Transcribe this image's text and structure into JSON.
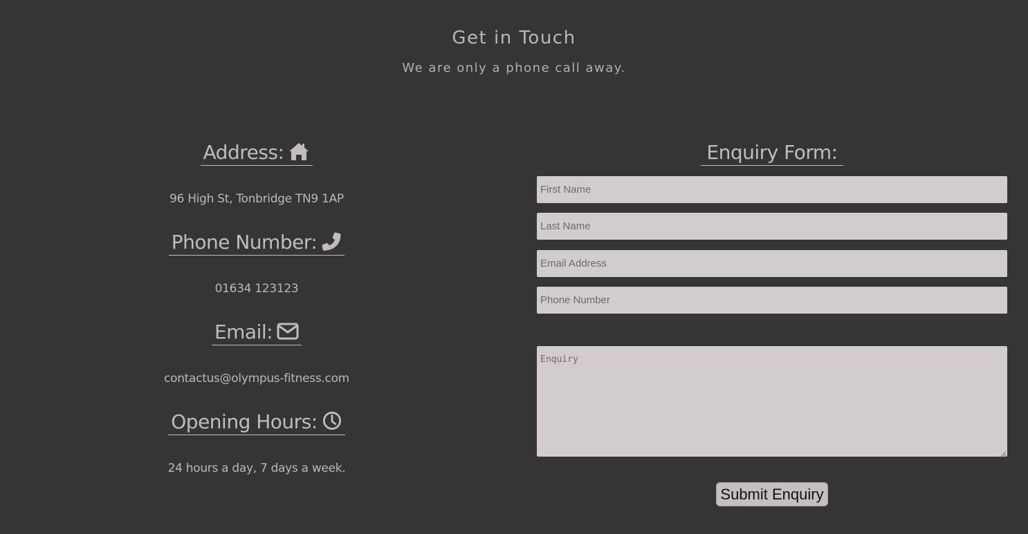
{
  "header": {
    "title": "Get in Touch",
    "subtitle": "We are only a phone call away."
  },
  "contact": {
    "address": {
      "heading": "Address:",
      "value": "96 High St, Tonbridge TN9 1AP",
      "icon": "home-icon"
    },
    "phone": {
      "heading": "Phone Number:",
      "value": "01634 123123",
      "icon": "phone-icon"
    },
    "email": {
      "heading": "Email:",
      "value": "contactus@olympus-fitness.com",
      "icon": "envelope-icon"
    },
    "hours": {
      "heading": "Opening Hours:",
      "value": "24 hours a day, 7 days a week.",
      "icon": "clock-icon"
    }
  },
  "form": {
    "heading": "Enquiry Form:",
    "first_name": {
      "placeholder": "First Name",
      "value": ""
    },
    "last_name": {
      "placeholder": "Last Name",
      "value": ""
    },
    "email": {
      "placeholder": "Email Address",
      "value": ""
    },
    "phone": {
      "placeholder": "Phone Number",
      "value": ""
    },
    "enquiry": {
      "placeholder": "Enquiry",
      "value": ""
    },
    "submit_label": "Submit Enquiry"
  },
  "colors": {
    "background": "#353535",
    "text": "#bdb7b7",
    "field_background": "#d3cccc",
    "button_background": "#c6bfbf"
  }
}
